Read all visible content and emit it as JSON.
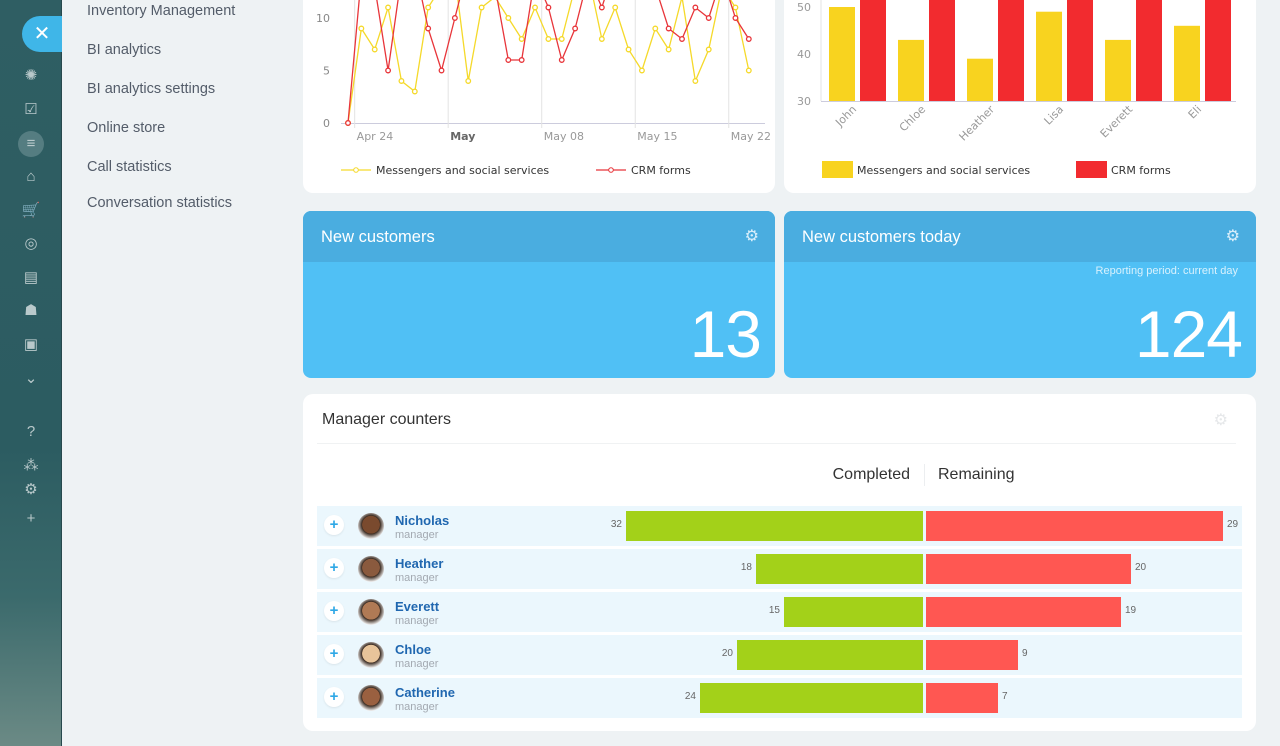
{
  "rail": {
    "close_icon": "close-icon",
    "icons": [
      "company-pulse-icon",
      "tasks-icon",
      "crm-funnel-icon",
      "bank-icon",
      "shop-cart-icon",
      "target-icon",
      "contact-card-icon",
      "robot-icon",
      "box-icon",
      "more-chevron-icon",
      "help-icon",
      "structure-icon",
      "settings-icon",
      "add-icon"
    ]
  },
  "menu": {
    "items": [
      "Inventory Management",
      "BI analytics",
      "BI analytics settings",
      "Online store",
      "Call statistics",
      "Conversation statistics"
    ]
  },
  "chart_data": [
    {
      "type": "line",
      "xlabel": "",
      "ylabel": "",
      "ylim": [
        0,
        15
      ],
      "yticks": [
        0,
        5,
        10
      ],
      "xticks": [
        "Apr 24",
        "May",
        "May 08",
        "May 15",
        "May 22"
      ],
      "x": [
        "Apr 23",
        "Apr 24",
        "Apr 25",
        "Apr 26",
        "Apr 27",
        "Apr 28",
        "Apr 29",
        "Apr 30",
        "May 01",
        "May 02",
        "May 03",
        "May 04",
        "May 05",
        "May 06",
        "May 07",
        "May 08",
        "May 09",
        "May 10",
        "May 11",
        "May 12",
        "May 13",
        "May 14",
        "May 15",
        "May 16",
        "May 17",
        "May 18",
        "May 19",
        "May 20",
        "May 21",
        "May 22",
        "May 23"
      ],
      "series": [
        {
          "name": "Messengers and social services",
          "color": "#f5d92a",
          "values": [
            0,
            9,
            7,
            11,
            4,
            3,
            11,
            13,
            14,
            4,
            11,
            12,
            10,
            8,
            11,
            8,
            8,
            13,
            14,
            8,
            11,
            7,
            5,
            9,
            7,
            12,
            4,
            7,
            13,
            11,
            5
          ]
        },
        {
          "name": "CRM forms",
          "color": "#e8353a",
          "values": [
            0,
            14,
            13,
            5,
            14,
            15,
            9,
            5,
            10,
            15,
            14,
            13,
            6,
            6,
            14,
            11,
            6,
            9,
            14,
            11,
            15,
            14,
            16,
            13,
            9,
            8,
            11,
            10,
            14,
            10,
            8
          ]
        }
      ],
      "legend": "bottom"
    },
    {
      "type": "bar",
      "xlabel": "",
      "ylabel": "",
      "ylim": [
        30,
        52
      ],
      "yticks": [
        30,
        40,
        50
      ],
      "categories": [
        "John",
        "Chloe",
        "Heather",
        "Lisa",
        "Everett",
        "Eli"
      ],
      "series": [
        {
          "name": "Messengers and social services",
          "color": "#f8d31f",
          "values": [
            50,
            43,
            39,
            49,
            43,
            46
          ]
        },
        {
          "name": "CRM forms",
          "color": "#f22b2f",
          "values": [
            56,
            56,
            56,
            56,
            56,
            56
          ]
        }
      ],
      "legend": "bottom"
    }
  ],
  "widgets": {
    "new_customers": {
      "title": "New customers",
      "value": "13"
    },
    "new_customers_today": {
      "title": "New customers today",
      "period": "Reporting period: current day",
      "value": "124"
    }
  },
  "managers": {
    "title": "Manager counters",
    "col_completed": "Completed",
    "col_remaining": "Remaining",
    "colors": {
      "completed": "#a3d119",
      "remaining": "#ff5752",
      "name": "#2067b0"
    },
    "rows": [
      {
        "name": "Nicholas",
        "role": "manager",
        "completed": 32,
        "remaining": 29
      },
      {
        "name": "Heather",
        "role": "manager",
        "completed": 18,
        "remaining": 20
      },
      {
        "name": "Everett",
        "role": "manager",
        "completed": 15,
        "remaining": 19
      },
      {
        "name": "Chloe",
        "role": "manager",
        "completed": 20,
        "remaining": 9
      },
      {
        "name": "Catherine",
        "role": "manager",
        "completed": 24,
        "remaining": 7
      }
    ]
  }
}
